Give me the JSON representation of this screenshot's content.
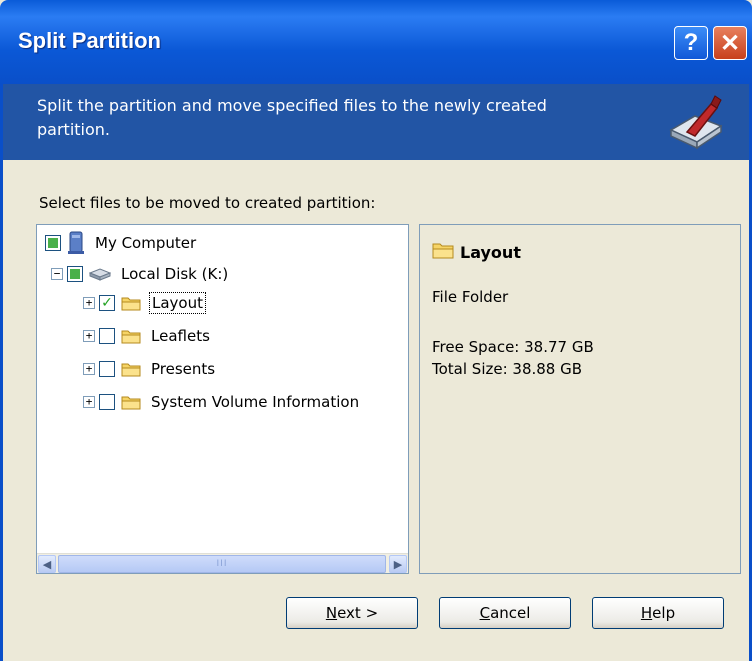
{
  "window": {
    "title": "Split Partition",
    "help_glyph": "?",
    "close_glyph": "✕"
  },
  "banner": {
    "text": "Split the partition and move specified files to the newly created partition.",
    "icon": "disk-split-icon"
  },
  "select_label": "Select files to be moved to created partition:",
  "tree": {
    "nodes": [
      {
        "label": "My Computer",
        "icon": "computer-icon",
        "check": "partial"
      },
      {
        "label": "Local Disk (K:)",
        "icon": "disk-icon",
        "check": "partial",
        "expander": "−"
      },
      {
        "label": "Layout",
        "icon": "folder-icon",
        "check": "checked",
        "expander": "+"
      },
      {
        "label": "Leaflets",
        "icon": "folder-icon",
        "check": "unchecked",
        "expander": "+"
      },
      {
        "label": "Presents",
        "icon": "folder-icon",
        "check": "unchecked",
        "expander": "+"
      },
      {
        "label": "System Volume Information",
        "icon": "folder-icon",
        "check": "unchecked",
        "expander": "+"
      }
    ],
    "scroll_left": "◀",
    "scroll_right": "▶",
    "scroll_grip": "III"
  },
  "info": {
    "name": "Layout",
    "type": "File Folder",
    "free_space": "Free Space: 38.77 GB",
    "total_size": "Total Size: 38.88 GB"
  },
  "buttons": {
    "next_ul": "N",
    "next_rest": "ext >",
    "cancel_ul": "C",
    "cancel_rest": "ancel",
    "help_ul": "H",
    "help_rest": "elp"
  },
  "colors": {
    "titlebar": "#0a5bd8",
    "banner": "#2255a5",
    "dialog_bg": "#ece9d8",
    "check_green": "#21a121"
  }
}
